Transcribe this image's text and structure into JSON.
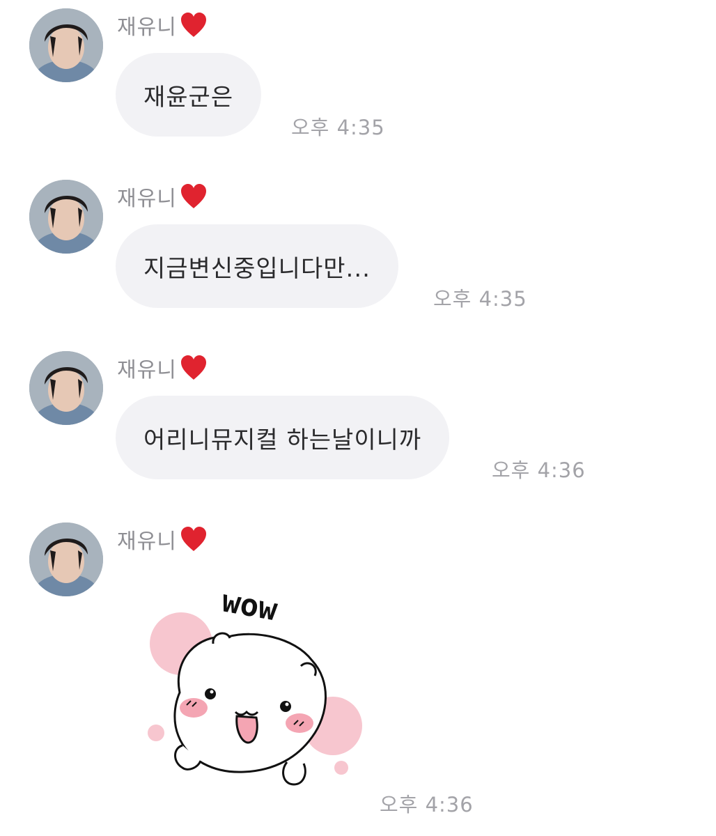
{
  "messages": [
    {
      "sender": "재유니",
      "text": "재윤군은",
      "time": "오후 4:35"
    },
    {
      "sender": "재유니",
      "text": "지금변신중입니다만...",
      "time": "오후 4:35"
    },
    {
      "sender": "재유니",
      "text": "어리니뮤지컬 하는날이니까",
      "time": "오후 4:36"
    },
    {
      "sender": "재유니",
      "sticker": {
        "text": "wow",
        "icon": "wow-bear-sticker"
      },
      "time": "오후 4:36"
    }
  ],
  "colors": {
    "bubble": "#f2f2f5",
    "sender_name": "#8e8e93",
    "timestamp": "#a3a3a8",
    "heart": "#e0232f",
    "sticker_blush": "#f7c6cf"
  }
}
